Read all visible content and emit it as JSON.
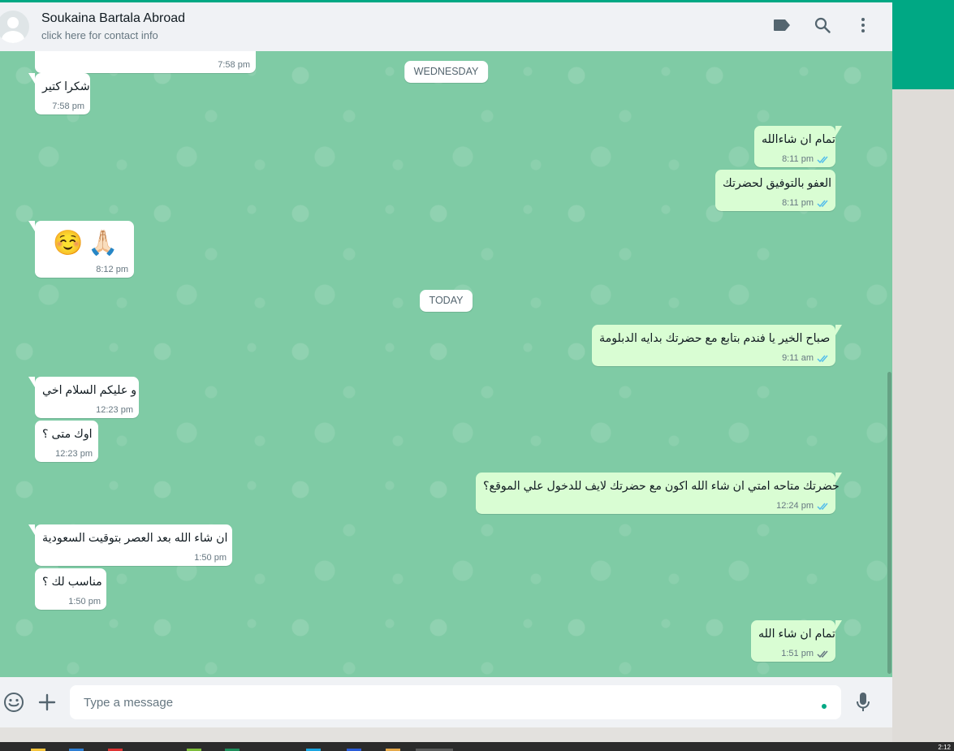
{
  "header": {
    "contact_name": "Soukaina Bartala Abroad",
    "contact_subtitle": "click here for contact info",
    "icons": [
      "label-icon",
      "search-icon",
      "menu-icon"
    ]
  },
  "chat": {
    "day_separators": {
      "wednesday": "WEDNESDAY",
      "today": "TODAY"
    },
    "messages": [
      {
        "dir": "in",
        "text": "",
        "time": "7:58 pm"
      },
      {
        "dir": "in",
        "text": "شكرا كتير",
        "time": "7:58 pm"
      },
      {
        "dir": "out",
        "text": "تمام ان شاءالله",
        "time": "8:11 pm",
        "status": "read"
      },
      {
        "dir": "out",
        "text": "العفو بالتوفيق لحضرتك",
        "time": "8:11 pm",
        "status": "read"
      },
      {
        "dir": "in",
        "text": "☺️🙏🏻",
        "time": "8:12 pm"
      },
      {
        "dir": "out",
        "text": "صباح الخير يا فندم بتابع مع حضرتك بدايه الدبلومة",
        "time": "9:11 am",
        "status": "read"
      },
      {
        "dir": "in",
        "text": "و عليكم السلام اخي",
        "time": "12:23 pm"
      },
      {
        "dir": "in",
        "text": "اوك متى ؟",
        "time": "12:23 pm"
      },
      {
        "dir": "out",
        "text": "حضرتك متاحه امتي ان شاء الله اكون مع حضرتك لايف للدخول علي الموقع؟",
        "time": "12:24 pm",
        "status": "read"
      },
      {
        "dir": "in",
        "text": "ان شاء الله بعد العصر بتوقيت السعودية",
        "time": "1:50 pm"
      },
      {
        "dir": "in",
        "text": "مناسب لك ؟",
        "time": "1:50 pm"
      },
      {
        "dir": "out",
        "text": "تمام ان شاء الله",
        "time": "1:51 pm",
        "status": "delivered"
      }
    ]
  },
  "footer": {
    "placeholder": "Type a message",
    "icons": [
      "emoji-icon",
      "attach-icon",
      "mic-icon"
    ]
  },
  "colors": {
    "accent": "#00a884",
    "chat_bg": "#7fcba5",
    "outgoing_bubble": "#d9fdd3",
    "incoming_bubble": "#ffffff",
    "read_tick": "#53bdeb",
    "delivered_tick": "#667781"
  },
  "taskbar": {
    "clock": "2:12"
  }
}
